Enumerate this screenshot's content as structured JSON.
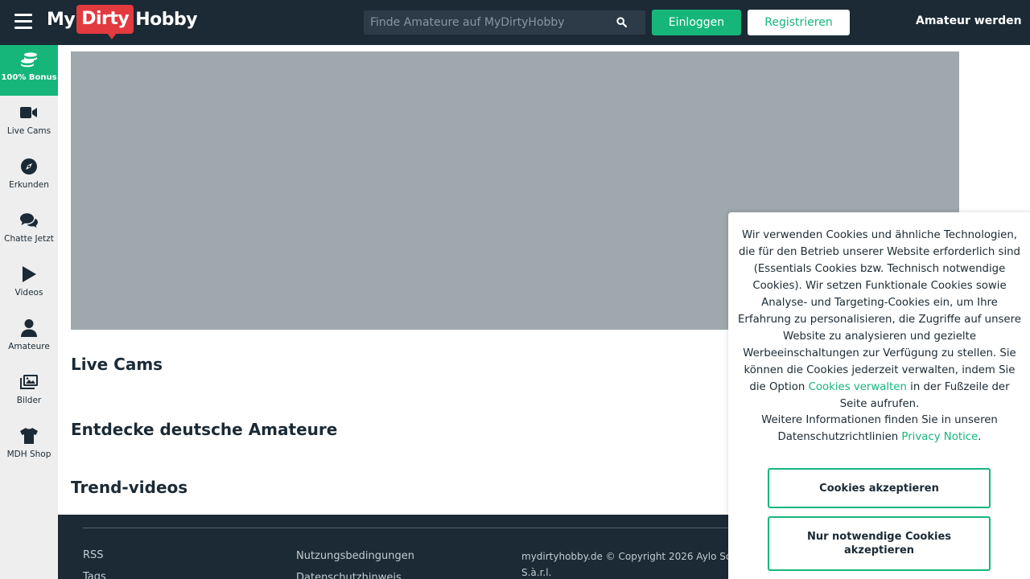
{
  "header": {
    "logo": {
      "my": "My",
      "dirty": "Dirty",
      "hobby": "Hobby"
    },
    "search_placeholder": "Finde Amateure auf MyDirtyHobby",
    "login_label": "Einloggen",
    "register_label": "Registrieren",
    "become_amateur_label": "Amateur werden"
  },
  "sidebar": {
    "items": [
      {
        "label": "100% Bonus",
        "icon": "coins-icon"
      },
      {
        "label": "Live Cams",
        "icon": "video-camera-icon"
      },
      {
        "label": "Erkunden",
        "icon": "compass-icon"
      },
      {
        "label": "Chatte Jetzt",
        "icon": "chat-icon"
      },
      {
        "label": "Videos",
        "icon": "play-icon"
      },
      {
        "label": "Amateure",
        "icon": "user-icon"
      },
      {
        "label": "Bilder",
        "icon": "images-icon"
      },
      {
        "label": "MDH Shop",
        "icon": "shirt-icon"
      }
    ]
  },
  "main": {
    "sections": {
      "live_cams": "Live Cams",
      "discover": "Entdecke deutsche Amateure",
      "trend": "Trend-videos"
    }
  },
  "footer": {
    "links_col1": [
      "RSS",
      "Tags"
    ],
    "links_col2": [
      "Nutzungsbedingungen",
      "Datenschutzhinweis"
    ],
    "copyright": "mydirtyhobby.de © Copyright 2026 Aylo Social S.à.r.l."
  },
  "cookie": {
    "text_before_link": "Wir verwenden Cookies und ähnliche Technologien, die für den Betrieb unserer Website erforderlich sind (Essentials Cookies bzw. Technisch notwendige Cookies). Wir setzen Funktionale Cookies sowie Analyse- und Targeting-Cookies ein, um Ihre Erfahrung zu personalisieren, die Zugriffe auf unsere Website zu analysieren und gezielte Werbeeinschaltungen zur Verfügung zu stellen. Sie können die Cookies jederzeit verwalten, indem Sie die Option ",
    "manage_link": "Cookies verwalten",
    "text_after_link": " in der Fußzeile der Seite aufrufen.",
    "more_info_text": "Weitere Informationen finden Sie in unseren Datenschutzrichtlinien ",
    "privacy_link": "Privacy Notice",
    "more_info_end": ".",
    "accept_all_label": "Cookies akzeptieren",
    "accept_necessary_label": "Nur notwendige Cookies akzeptieren"
  },
  "colors": {
    "header_bg": "#1b2a35",
    "brand_green": "#16b67b",
    "logo_red": "#e23a3f",
    "sidebar_bg": "#eeeeee",
    "hero_placeholder": "#9ea8ad"
  }
}
